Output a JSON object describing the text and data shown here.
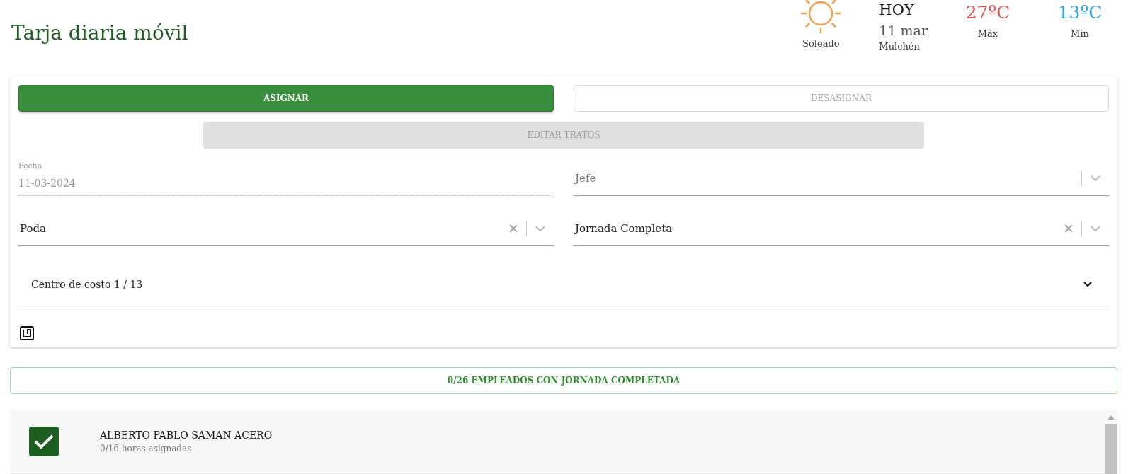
{
  "title": "Tarja diaria móvil",
  "weather": {
    "condition": "Soleado",
    "day": "HOY",
    "date": "11 mar",
    "place": "Mulchén",
    "max": {
      "value": "27ºC",
      "label": "Máx"
    },
    "min": {
      "value": "13ºC",
      "label": "Min"
    }
  },
  "buttons": [
    {
      "label": "ASIGNAR",
      "disabled": false
    },
    {
      "label": "DESASIGNAR",
      "disabled": true
    }
  ],
  "edit_button": {
    "label": "EDITAR TRATOS",
    "disabled": true
  },
  "fields": [
    {
      "kind": "date",
      "label": "Fecha",
      "value": "11-03-2024",
      "disabled": true
    },
    {
      "kind": "select",
      "placeholder": "Jefe",
      "clearable": false
    },
    {
      "kind": "select",
      "value": "Poda",
      "clearable": true
    },
    {
      "kind": "select",
      "value": "Jornada Completa",
      "clearable": true
    }
  ],
  "cost_center": {
    "label": "Centro de costo 1 / 13",
    "expanded": false
  },
  "summary": "0/26 EMPLEADOS CON JORNADA COMPLETADA",
  "employees": [
    {
      "name": "ALBERTO PABLO SAMAN ACERO",
      "hours": "0/16 horas asignadas",
      "checked": true
    }
  ]
}
